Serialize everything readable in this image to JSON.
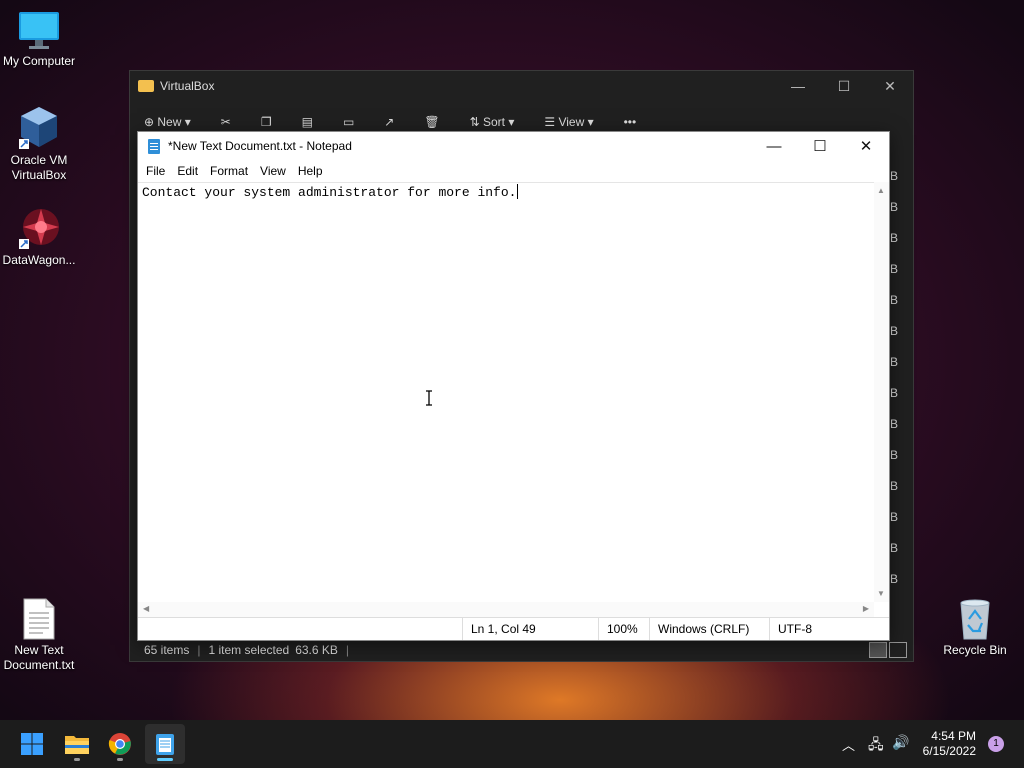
{
  "desktop": {
    "icons": [
      {
        "label": "My Computer"
      },
      {
        "label": "Oracle VM VirtualBox"
      },
      {
        "label": "DataWagon..."
      },
      {
        "label": "New Text Document.txt"
      },
      {
        "label": "Recycle Bin"
      }
    ]
  },
  "explorer": {
    "title": "VirtualBox",
    "toolbar": {
      "new_label": "New",
      "sort_label": "Sort",
      "view_label": "View",
      "more_label": "•••"
    },
    "size_column": [
      "B",
      "B",
      "B",
      "B",
      "B",
      "B",
      "B",
      "B",
      "B",
      "B",
      "B",
      "B",
      "B",
      "B"
    ],
    "status": {
      "items": "65 items",
      "selected": "1 item selected",
      "size": "63.6 KB"
    }
  },
  "notepad": {
    "title": "*New Text Document.txt - Notepad",
    "menu": [
      "File",
      "Edit",
      "Format",
      "View",
      "Help"
    ],
    "content": "Contact your system administrator for more info.",
    "status": {
      "position": "Ln 1, Col 49",
      "zoom": "100%",
      "line_ending": "Windows (CRLF)",
      "encoding": "UTF-8"
    }
  },
  "taskbar": {
    "time": "4:54 PM",
    "date": "6/15/2022",
    "notification_count": "1"
  }
}
